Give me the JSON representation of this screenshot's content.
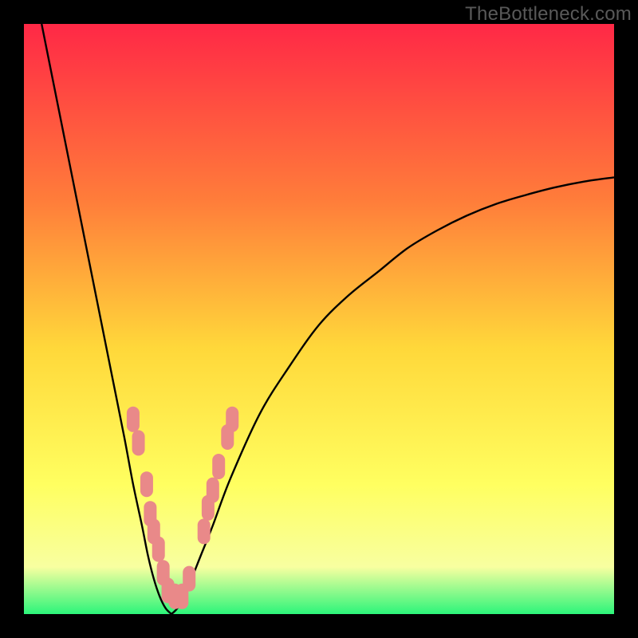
{
  "watermark": "TheBottleneck.com",
  "colors": {
    "frame": "#000000",
    "gradient_top": "#ff2846",
    "gradient_mid1": "#ff7d3a",
    "gradient_mid2": "#ffd83a",
    "gradient_mid3": "#ffff60",
    "gradient_mid4": "#f8ffa0",
    "gradient_bottom": "#2cf57a",
    "curve": "#000000",
    "markers": "#e98989"
  },
  "chart_data": {
    "type": "line",
    "title": "",
    "xlabel": "",
    "ylabel": "",
    "xlim": [
      0,
      100
    ],
    "ylim": [
      0,
      100
    ],
    "series": [
      {
        "name": "left-branch",
        "x": [
          3,
          5,
          7,
          9,
          11,
          13,
          15,
          17,
          18.5,
          20,
          21,
          22,
          23,
          24,
          25
        ],
        "y": [
          100,
          90,
          80,
          70,
          60,
          50,
          40,
          30,
          22,
          15,
          10,
          6,
          3,
          1,
          0
        ]
      },
      {
        "name": "right-branch",
        "x": [
          25,
          26,
          27,
          28,
          30,
          32,
          35,
          40,
          45,
          50,
          55,
          60,
          65,
          70,
          75,
          80,
          85,
          90,
          95,
          100
        ],
        "y": [
          0,
          1,
          3,
          5,
          10,
          15,
          23,
          34,
          42,
          49,
          54,
          58,
          62,
          65,
          67.5,
          69.5,
          71,
          72.3,
          73.3,
          74
        ]
      }
    ],
    "markers": [
      {
        "series": "left-branch",
        "x": 18.5,
        "y": 33,
        "shape": "rounded-bar"
      },
      {
        "series": "left-branch",
        "x": 19.4,
        "y": 29,
        "shape": "rounded-bar"
      },
      {
        "series": "left-branch",
        "x": 20.8,
        "y": 22,
        "shape": "rounded-bar"
      },
      {
        "series": "left-branch",
        "x": 21.4,
        "y": 17,
        "shape": "rounded-bar"
      },
      {
        "series": "left-branch",
        "x": 22.0,
        "y": 14,
        "shape": "rounded-bar"
      },
      {
        "series": "left-branch",
        "x": 22.8,
        "y": 11,
        "shape": "rounded-bar"
      },
      {
        "series": "left-branch",
        "x": 23.6,
        "y": 7,
        "shape": "rounded-bar"
      },
      {
        "series": "valley",
        "x": 24.4,
        "y": 4,
        "shape": "rounded-bar"
      },
      {
        "series": "valley",
        "x": 25.6,
        "y": 3,
        "shape": "rounded-bar"
      },
      {
        "series": "valley",
        "x": 26.8,
        "y": 3,
        "shape": "rounded-bar"
      },
      {
        "series": "right-branch",
        "x": 28.0,
        "y": 6,
        "shape": "rounded-bar"
      },
      {
        "series": "right-branch",
        "x": 30.5,
        "y": 14,
        "shape": "rounded-bar"
      },
      {
        "series": "right-branch",
        "x": 31.2,
        "y": 18,
        "shape": "rounded-bar"
      },
      {
        "series": "right-branch",
        "x": 32.0,
        "y": 21,
        "shape": "rounded-bar"
      },
      {
        "series": "right-branch",
        "x": 33.0,
        "y": 25,
        "shape": "rounded-bar"
      },
      {
        "series": "right-branch",
        "x": 34.5,
        "y": 30,
        "shape": "rounded-bar"
      },
      {
        "series": "right-branch",
        "x": 35.3,
        "y": 33,
        "shape": "rounded-bar"
      }
    ],
    "legend": null,
    "grid": false
  }
}
